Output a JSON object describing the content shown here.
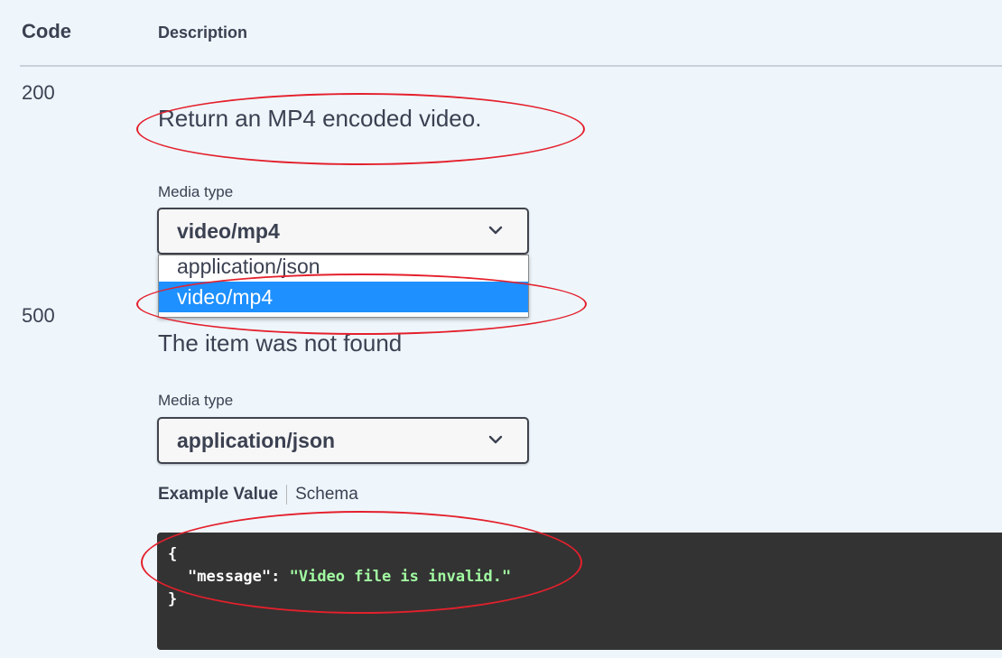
{
  "table": {
    "code_header": "Code",
    "description_header": "Description"
  },
  "responses": [
    {
      "code": "200",
      "description": "Return an MP4 encoded video.",
      "media_type_label": "Media type",
      "selected_media_type": "video/mp4",
      "dropdown_options": [
        "application/json",
        "video/mp4"
      ],
      "highlighted_option": "video/mp4"
    },
    {
      "code": "500",
      "description": "The item was not found",
      "media_type_label": "Media type",
      "selected_media_type": "application/json",
      "example_tab_active": "Example Value",
      "example_tab_inactive": "Schema",
      "example": {
        "open_brace": "{",
        "key": "\"message\"",
        "colon": ": ",
        "value": "\"Video file is invalid.\"",
        "close_brace": "}"
      }
    }
  ],
  "icons": {
    "select_chevron": "chevron-down-icon"
  },
  "colors": {
    "background": "#eef6fc",
    "text": "#3b4151",
    "selected_option": "#1e90ff",
    "code_block": "#333333",
    "json_string": "#a2fca2",
    "annotation": "#e4202c"
  }
}
